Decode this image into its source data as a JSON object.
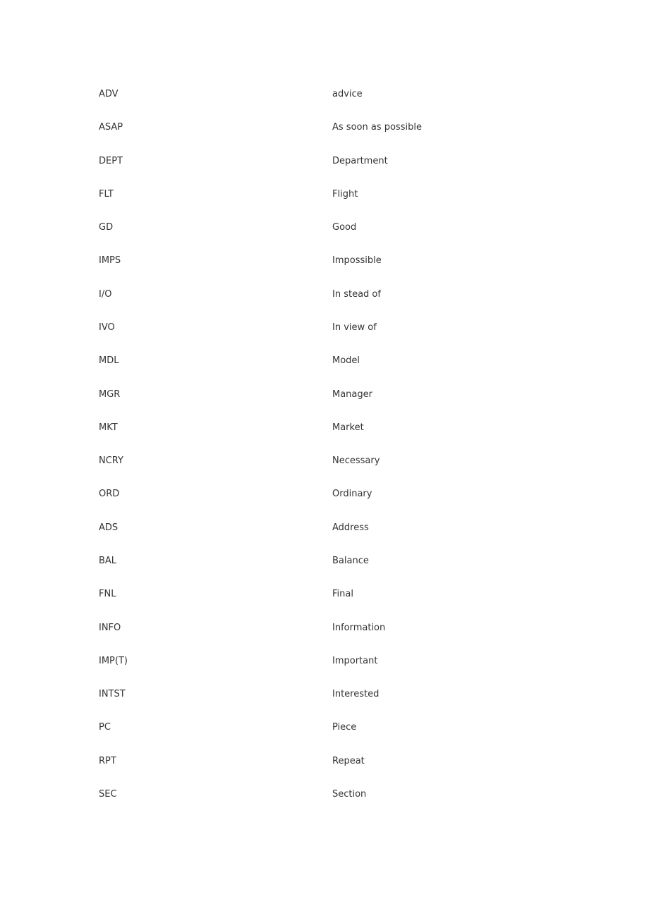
{
  "rows": [
    {
      "abbr": "ADV",
      "meaning": "advice"
    },
    {
      "abbr": "ASAP",
      "meaning": "As soon as possible"
    },
    {
      "abbr": "DEPT",
      "meaning": "Department"
    },
    {
      "abbr": "FLT",
      "meaning": "Flight"
    },
    {
      "abbr": "GD",
      "meaning": "Good"
    },
    {
      "abbr": "IMPS",
      "meaning": "Impossible"
    },
    {
      "abbr": "I/O",
      "meaning": "In stead of"
    },
    {
      "abbr": "IVO",
      "meaning": "In view of"
    },
    {
      "abbr": "MDL",
      "meaning": "Model"
    },
    {
      "abbr": "MGR",
      "meaning": "Manager"
    },
    {
      "abbr": "MKT",
      "meaning": "Market"
    },
    {
      "abbr": "NCRY",
      "meaning": "Necessary"
    },
    {
      "abbr": "ORD",
      "meaning": "Ordinary"
    },
    {
      "abbr": "ADS",
      "meaning": "Address"
    },
    {
      "abbr": "BAL",
      "meaning": "Balance"
    },
    {
      "abbr": "FNL",
      "meaning": "Final"
    },
    {
      "abbr": "INFO",
      "meaning": "Information"
    },
    {
      "abbr": "IMP(T)",
      "meaning": "Important"
    },
    {
      "abbr": "INTST",
      "meaning": "Interested"
    },
    {
      "abbr": "PC",
      "meaning": "Piece"
    },
    {
      "abbr": "RPT",
      "meaning": "Repeat"
    },
    {
      "abbr": "SEC",
      "meaning": "Section"
    }
  ]
}
